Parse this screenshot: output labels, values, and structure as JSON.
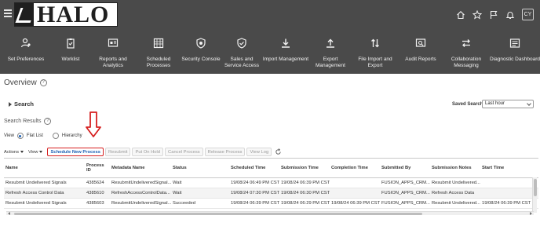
{
  "header": {
    "logo_text": "HALO",
    "avatar_initials": "CY",
    "icons": [
      "home-icon",
      "star-icon",
      "flag-icon",
      "bell-icon"
    ]
  },
  "nav": [
    {
      "label": "Set Preferences",
      "icon": "user-settings-icon"
    },
    {
      "label": "Worklist",
      "icon": "clipboard-check-icon"
    },
    {
      "label": "Reports and Analytics",
      "icon": "reports-icon"
    },
    {
      "label": "Scheduled Processes",
      "icon": "calendar-grid-icon"
    },
    {
      "label": "Security Console",
      "icon": "shield-gear-icon"
    },
    {
      "label": "Sales and Service Access",
      "icon": "shield-check-icon"
    },
    {
      "label": "Import Management",
      "icon": "download-icon"
    },
    {
      "label": "Export Management",
      "icon": "upload-icon"
    },
    {
      "label": "File Import and Export",
      "icon": "up-down-arrows-icon"
    },
    {
      "label": "Audit Reports",
      "icon": "audit-icon"
    },
    {
      "label": "Collaboration Messaging",
      "icon": "swap-arrows-icon"
    },
    {
      "label": "Diagnostic Dashboard",
      "icon": "dashboard-icon"
    }
  ],
  "page": {
    "title": "Overview",
    "search_label": "Search",
    "saved_search_label": "Saved Search",
    "saved_search_value": "Last hour",
    "results_title": "Search Results",
    "view_label": "View",
    "view_options": [
      "Flat List",
      "Hierarchy"
    ],
    "view_selected": "Flat List"
  },
  "toolbar": {
    "actions_label": "Actions",
    "view_label": "View",
    "buttons": [
      "Schedule New Process",
      "Resubmit",
      "Put On Hold",
      "Cancel Process",
      "Release Process",
      "View Log"
    ]
  },
  "table": {
    "headers": [
      "Name",
      "Process ID",
      "Metadata Name",
      "Status",
      "Scheduled Time",
      "Submission Time",
      "Completion Time",
      "Submitted By",
      "Submission Notes",
      "Start Time"
    ],
    "rows": [
      [
        "Resubmit Undelivered Signals",
        "4385624",
        "ResubmitUndeliveredSignal...",
        "Wait",
        "19/08/24 06:49 PM CST",
        "19/08/24 06:39 PM CST",
        "",
        "FUSION_APPS_CRM...",
        "Resubmit Undelivered...",
        ""
      ],
      [
        "Refresh Access Control Data",
        "4385610",
        "RefreshAccessControlData...",
        "Wait",
        "19/08/24 07:30 PM CST",
        "19/08/24 06:30 PM CST",
        "",
        "FUSION_APPS_CRM...",
        "Refresh Access Data",
        ""
      ],
      [
        "Resubmit Undelivered Signals",
        "4385603",
        "ResubmitUndeliveredSignal...",
        "Succeeded",
        "19/08/24 06:39 PM CST",
        "19/08/24 06:29 PM CST",
        "19/08/24 06:39 PM CST",
        "FUSION_APPS_CRM...",
        "Resubmit Undelivered...",
        "19/08/24 06:39 PM CST"
      ]
    ]
  },
  "colors": {
    "header_bg": "#4a4a4a",
    "accent_blue": "#1a5fb4",
    "annotation_red": "#d62020"
  }
}
